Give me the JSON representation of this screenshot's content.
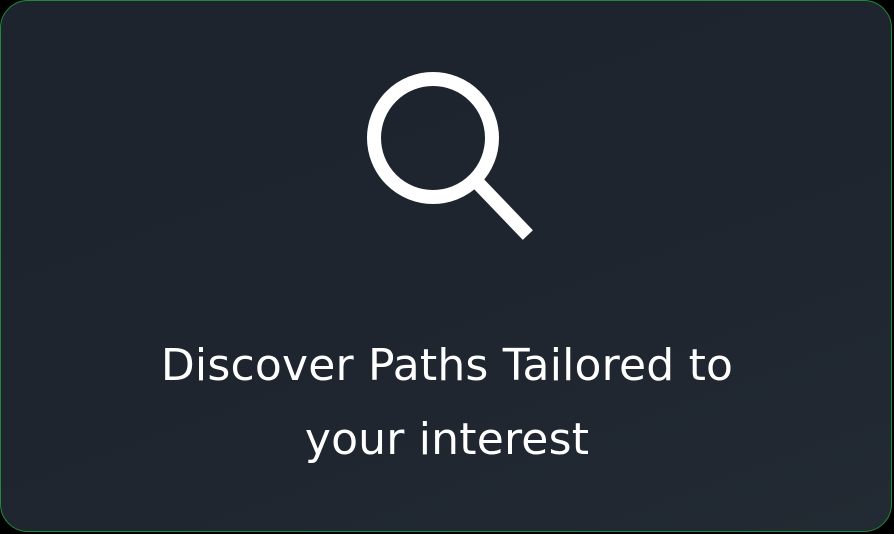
{
  "card": {
    "icon": "search-icon",
    "headline_line1": "Discover Paths Tailored to",
    "headline_line2": "your interest"
  },
  "colors": {
    "background": "#1f252f",
    "border": "#1f8a3a",
    "text": "#ffffff",
    "icon": "#ffffff"
  }
}
